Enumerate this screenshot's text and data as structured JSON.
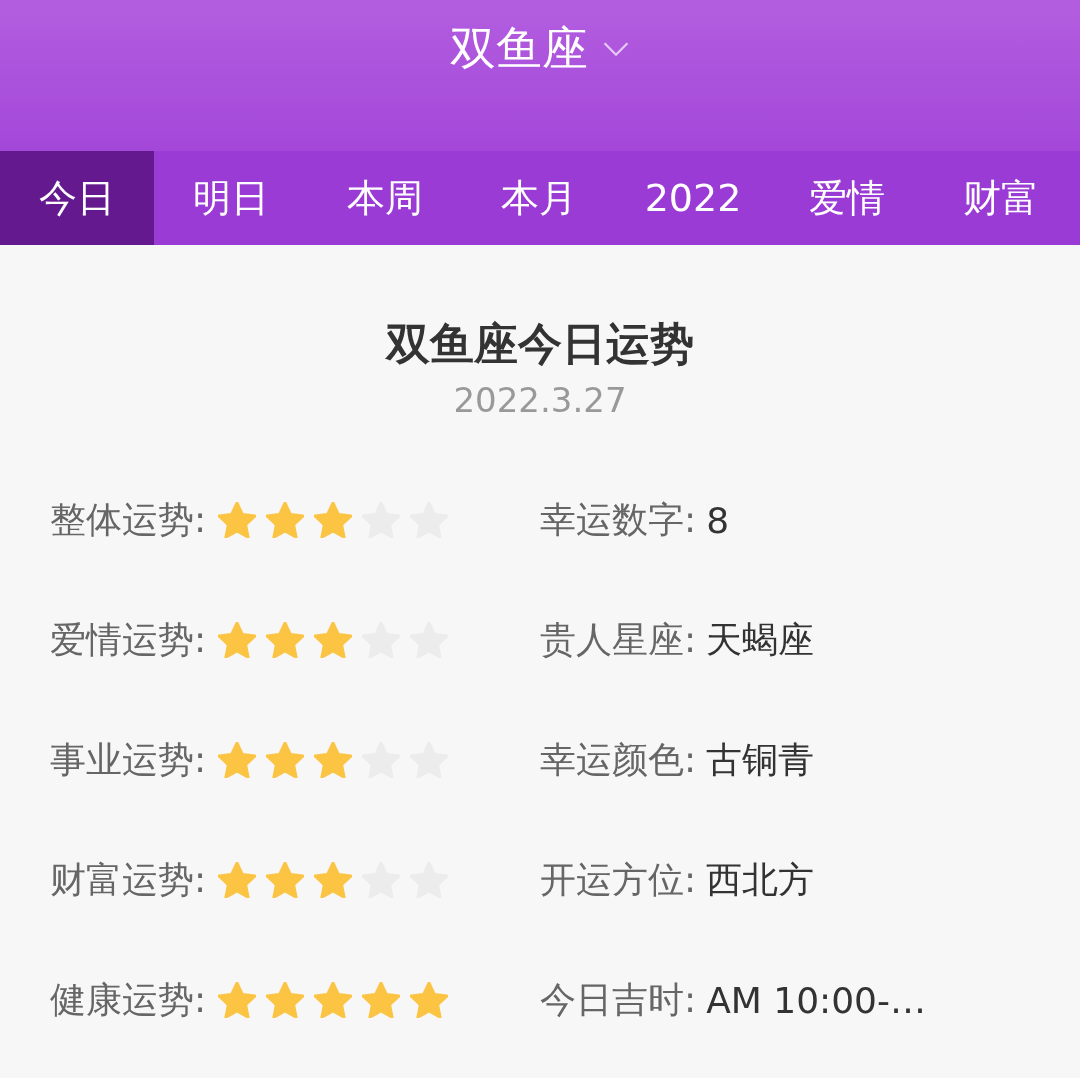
{
  "header": {
    "title": "双鱼座"
  },
  "tabs": [
    {
      "label": "今日",
      "selected": true
    },
    {
      "label": "明日",
      "selected": false
    },
    {
      "label": "本周",
      "selected": false
    },
    {
      "label": "本月",
      "selected": false
    },
    {
      "label": "2022",
      "selected": false
    },
    {
      "label": "爱情",
      "selected": false
    },
    {
      "label": "财富",
      "selected": false
    }
  ],
  "fortune": {
    "title": "双鱼座今日运势",
    "date": "2022.3.27",
    "ratings": [
      {
        "label": "整体运势:",
        "stars": 3
      },
      {
        "label": "爱情运势:",
        "stars": 3
      },
      {
        "label": "事业运势:",
        "stars": 3
      },
      {
        "label": "财富运势:",
        "stars": 3
      },
      {
        "label": "健康运势:",
        "stars": 5
      }
    ],
    "facts": [
      {
        "label": "幸运数字:",
        "value": "8"
      },
      {
        "label": "贵人星座:",
        "value": "天蝎座"
      },
      {
        "label": "幸运颜色:",
        "value": "古铜青"
      },
      {
        "label": "开运方位:",
        "value": "西北方"
      },
      {
        "label": "今日吉时:",
        "value": "AM 10:00-…"
      }
    ]
  }
}
